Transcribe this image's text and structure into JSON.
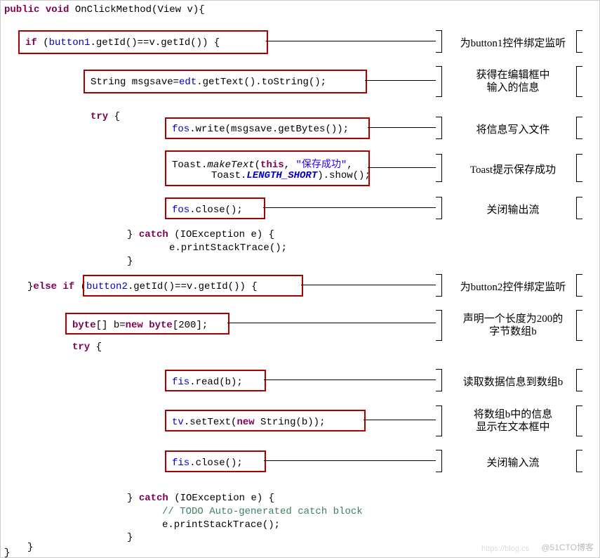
{
  "code": {
    "line1_a": "public",
    "line1_b": " void",
    "line1_c": " OnClickMethod(View v){",
    "if_kw": "if",
    "if_cond_a": " (",
    "if_cond_b": "button1",
    "if_cond_c": ".getId()==v.getId())",
    "if_brace": " {",
    "msgsave_a": "String msgsave=",
    "msgsave_b": "edt",
    "msgsave_c": ".getText().toString();",
    "try1": "try",
    "try1_b": " {",
    "fos_write_a": "fos",
    "fos_write_b": ".write(msgsave.getBytes());",
    "toast_a": "Toast.",
    "toast_b": "makeText",
    "toast_c": "(",
    "toast_d": "this",
    "toast_e": ", ",
    "toast_f": "\"保存成功\"",
    "toast_g": ",",
    "toast2_a": "Toast.",
    "toast2_b": "LENGTH_SHORT",
    "toast2_c": ").show();",
    "fos_close_a": "fos",
    "fos_close_b": ".close();",
    "catch1_a": "} ",
    "catch1_b": "catch",
    "catch1_c": " (IOException e) {",
    "stack1": "e.printStackTrace();",
    "close1": "}",
    "elseif_a": "}",
    "elseif_b": "else if",
    "elseif_c": " (",
    "elseif_d": "button2",
    "elseif_e": ".getId()==v.getId())",
    "elseif_f": " {",
    "byte_a": "byte",
    "byte_b": "[] b=",
    "byte_c": "new byte",
    "byte_d": "[200];",
    "try2": "try",
    "try2_b": " {",
    "fis_read_a": "fis",
    "fis_read_b": ".read(b);",
    "tv_a": "tv",
    "tv_b": ".setText(",
    "tv_c": "new",
    "tv_d": " String(b));",
    "fis_close_a": "fis",
    "fis_close_b": ".close();",
    "catch2_a": "} ",
    "catch2_b": "catch",
    "catch2_c": " (IOException e) {",
    "todo": "// TODO Auto-generated catch block",
    "stack2": "e.printStackTrace();",
    "close2": "}",
    "close3": "}",
    "close4": "}"
  },
  "annot": {
    "a1": "为button1控件绑定监听",
    "a2a": "获得在编辑框中",
    "a2b": "输入的信息",
    "a3": "将信息写入文件",
    "a4": "Toast提示保存成功",
    "a5": "关闭输出流",
    "a6": "为button2控件绑定监听",
    "a7a": "声明一个长度为200的",
    "a7b": "字节数组b",
    "a8": "读取数据信息到数组b",
    "a9a": "将数组b中的信息",
    "a9b": "显示在文本框中",
    "a10": "关闭输入流"
  },
  "watermark": "@51CTO博客",
  "watermark2": "https://blog.cs"
}
